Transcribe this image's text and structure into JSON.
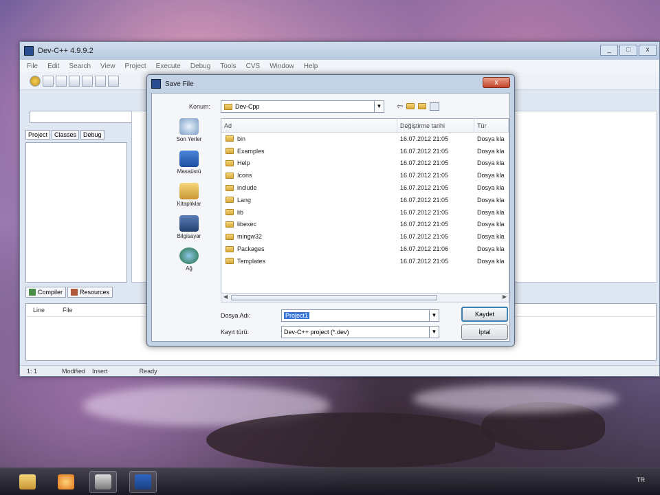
{
  "app": {
    "title": "Dev-C++ 4.9.9.2",
    "menu": [
      "File",
      "Edit",
      "Search",
      "View",
      "Project",
      "Execute",
      "Debug",
      "Tools",
      "CVS",
      "Window",
      "Help"
    ],
    "left_tabs": [
      "Project",
      "Classes",
      "Debug"
    ],
    "bottom_tabs": [
      "Compiler",
      "Resources"
    ],
    "output_headers": [
      "Line",
      "File"
    ],
    "status": {
      "position": "1: 1",
      "modified": "Modified",
      "insert": "Insert",
      "ready": "Ready"
    },
    "window_controls": [
      "_",
      "□",
      "x"
    ]
  },
  "dialog": {
    "title": "Save File",
    "close_glyph": "x",
    "location_label": "Konum:",
    "location_value": "Dev-Cpp",
    "places": [
      "Son Yerler",
      "Masaüstü",
      "Kitaplıklar",
      "Bilgisayar",
      "Ağ"
    ],
    "columns": {
      "name": "Ad",
      "date": "Değiştirme tarihi",
      "type": "Tür"
    },
    "files": [
      {
        "name": "bin",
        "date": "16.07.2012 21:05",
        "type": "Dosya kla"
      },
      {
        "name": "Examples",
        "date": "16.07.2012 21:05",
        "type": "Dosya kla"
      },
      {
        "name": "Help",
        "date": "16.07.2012 21:05",
        "type": "Dosya kla"
      },
      {
        "name": "Icons",
        "date": "16.07.2012 21:05",
        "type": "Dosya kla"
      },
      {
        "name": "include",
        "date": "16.07.2012 21:05",
        "type": "Dosya kla"
      },
      {
        "name": "Lang",
        "date": "16.07.2012 21:05",
        "type": "Dosya kla"
      },
      {
        "name": "lib",
        "date": "16.07.2012 21:05",
        "type": "Dosya kla"
      },
      {
        "name": "libexec",
        "date": "16.07.2012 21:05",
        "type": "Dosya kla"
      },
      {
        "name": "mingw32",
        "date": "16.07.2012 21:05",
        "type": "Dosya kla"
      },
      {
        "name": "Packages",
        "date": "16.07.2012 21:06",
        "type": "Dosya kla"
      },
      {
        "name": "Templates",
        "date": "16.07.2012 21:05",
        "type": "Dosya kla"
      }
    ],
    "filename_label": "Dosya Adı:",
    "filename_value": "Project1",
    "filetype_label": "Kayıt türü:",
    "filetype_value": "Dev-C++ project (*.dev)",
    "save_button": "Kaydet",
    "cancel_button": "İptal"
  },
  "taskbar": {
    "apps": [
      "explorer-icon",
      "media-player-icon",
      "camera-icon",
      "devcpp-icon"
    ],
    "tray_lang": "TR"
  }
}
